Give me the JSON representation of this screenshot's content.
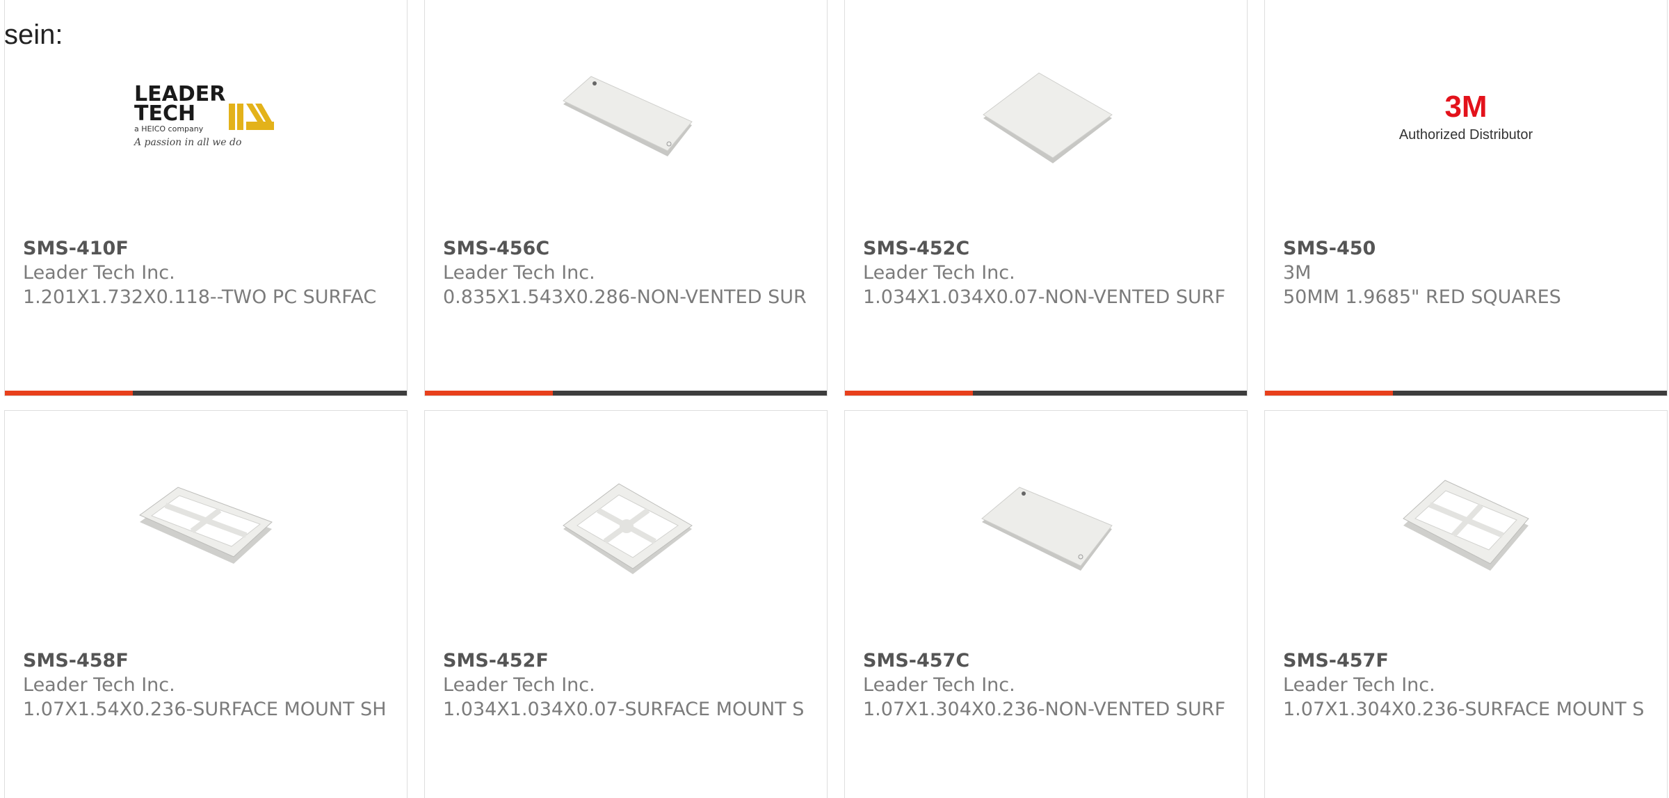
{
  "intro": {
    "text": "sein:"
  },
  "colors": {
    "accent": "#e8401c",
    "bar": "#3d3d3d",
    "border": "#dedede"
  },
  "products": [
    {
      "part": "SMS-410F",
      "manufacturer": "Leader Tech Inc.",
      "description": "1.201X1.732X0.118--TWO PC SURFAC",
      "image": "leader-tech-logo",
      "logo": {
        "line1": "LEADER",
        "line2": "TECH",
        "tag": "a HEICO company",
        "script": "A passion in all we do"
      }
    },
    {
      "part": "SMS-456C",
      "manufacturer": "Leader Tech Inc.",
      "description": "0.835X1.543X0.286-NON-VENTED SUR",
      "image": "shield-cover-image"
    },
    {
      "part": "SMS-452C",
      "manufacturer": "Leader Tech Inc.",
      "description": "1.034X1.034X0.07-NON-VENTED SURF",
      "image": "shield-cover-image"
    },
    {
      "part": "SMS-450",
      "manufacturer": "3M",
      "description": "50MM 1.9685\" RED SQUARES",
      "image": "3m-logo",
      "logo": {
        "brand": "3M",
        "caption": "Authorized Distributor"
      }
    },
    {
      "part": "SMS-458F",
      "manufacturer": "Leader Tech Inc.",
      "description": "1.07X1.54X0.236-SURFACE MOUNT SH",
      "image": "shield-frame-image"
    },
    {
      "part": "SMS-452F",
      "manufacturer": "Leader Tech Inc.",
      "description": "1.034X1.034X0.07-SURFACE MOUNT S",
      "image": "shield-frame-image"
    },
    {
      "part": "SMS-457C",
      "manufacturer": "Leader Tech Inc.",
      "description": "1.07X1.304X0.236-NON-VENTED SURF",
      "image": "shield-cover-image"
    },
    {
      "part": "SMS-457F",
      "manufacturer": "Leader Tech Inc.",
      "description": "1.07X1.304X0.236-SURFACE MOUNT S",
      "image": "shield-frame-image"
    }
  ]
}
